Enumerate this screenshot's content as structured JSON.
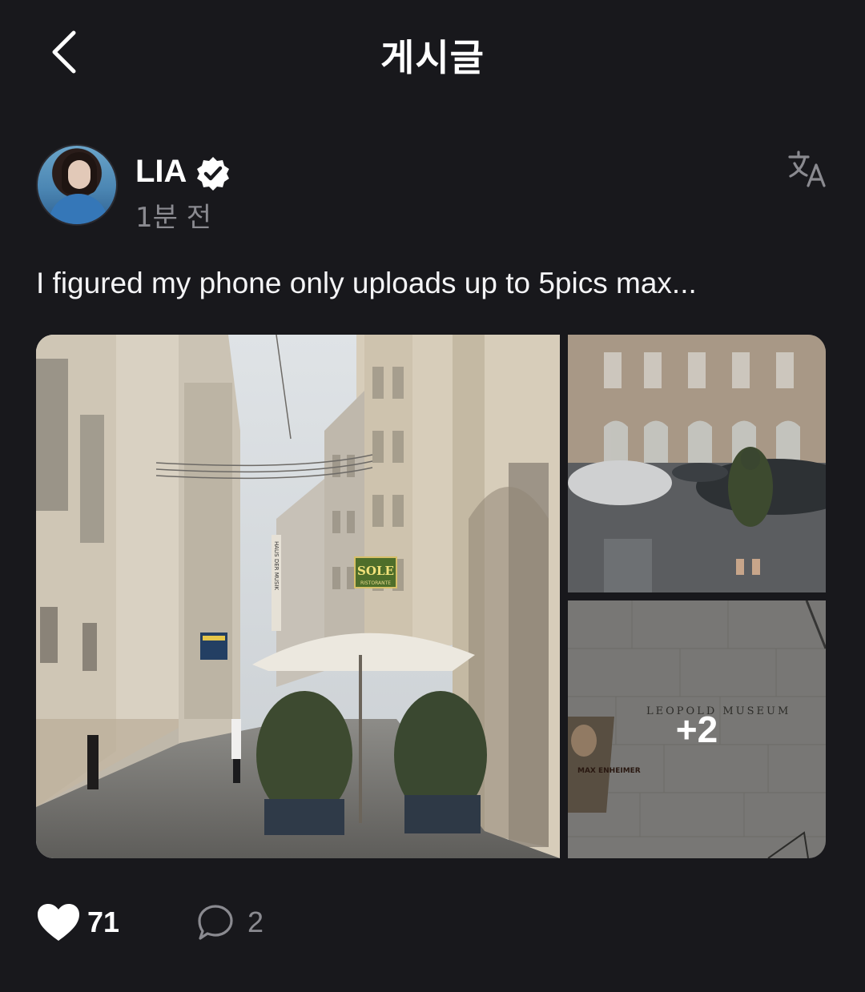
{
  "header": {
    "title": "게시글",
    "back_icon": "chevron-left-icon"
  },
  "author": {
    "name": "LIA",
    "verified": true,
    "time": "1분 전"
  },
  "post": {
    "text": "I figured my phone only uploads up to 5pics max...",
    "images": [
      {
        "description": "street"
      },
      {
        "description": "mirror"
      },
      {
        "description": "museum-wall"
      }
    ],
    "more_count_label": "+2",
    "image_texts": {
      "sign_sole": "SOLE",
      "sign_ristorante": "RISTORANTE",
      "sign_haus": "HAUS DER MUSIK",
      "wall_text": "LEOPOLD  MUSEUM",
      "poster_text": "MAX ENHEIMER"
    }
  },
  "actions": {
    "likes": "71",
    "comments": "2"
  },
  "colors": {
    "background": "#18181c",
    "secondary_text": "#8a8a90",
    "accent": "#ffffff"
  }
}
